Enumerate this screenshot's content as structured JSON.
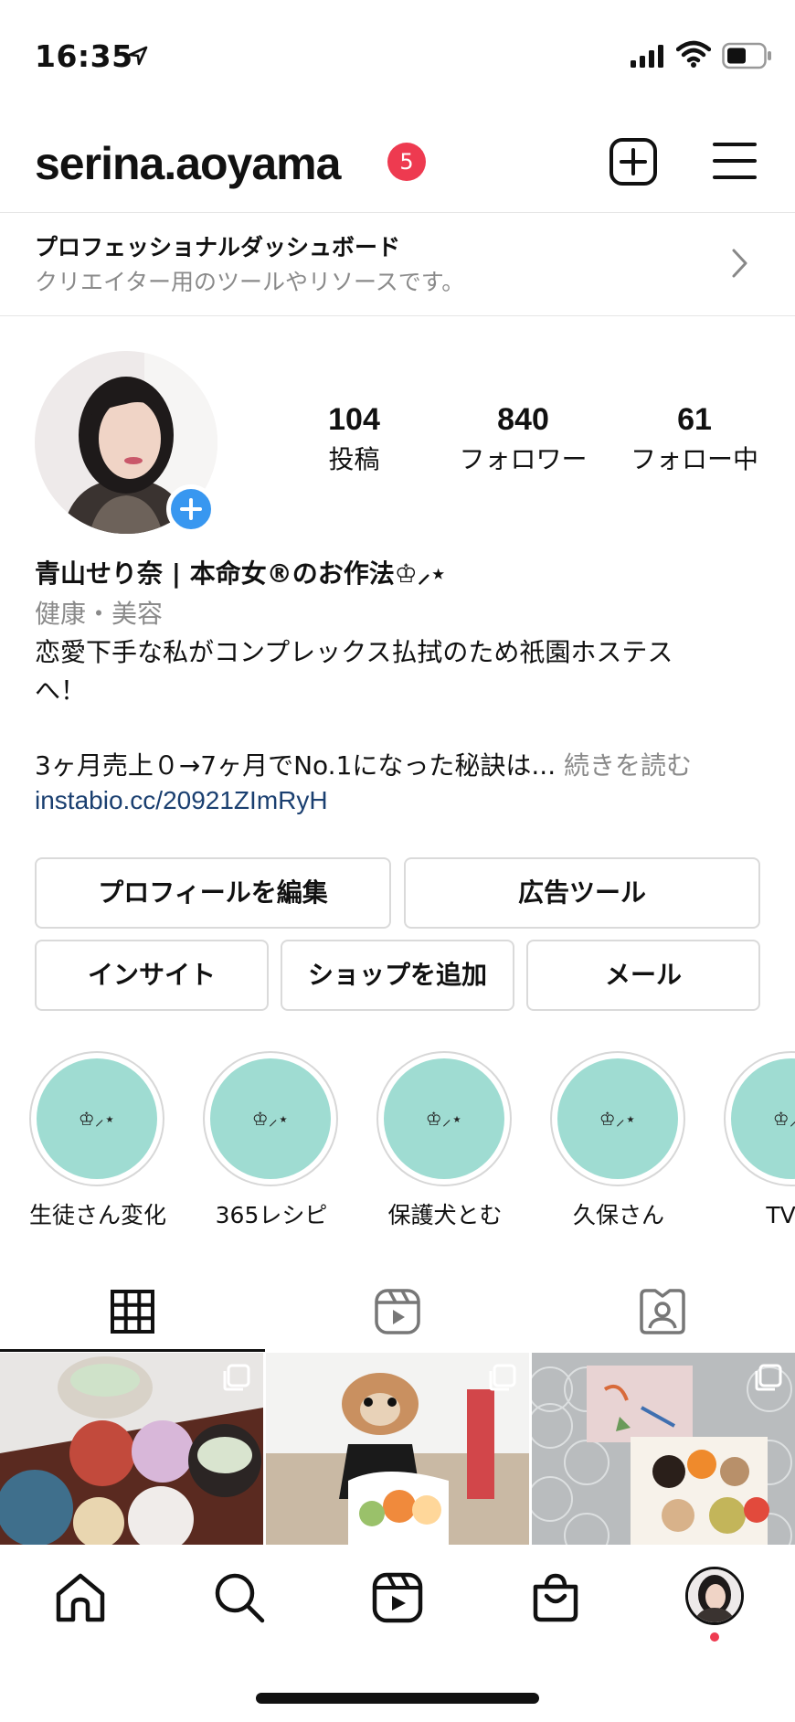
{
  "status_bar": {
    "time": "16:35"
  },
  "header": {
    "username": "serina.aoyama",
    "notification_count": "5"
  },
  "dashboard": {
    "title": "プロフェッショナルダッシュボード",
    "subtitle": "クリエイター用のツールやリソースです。"
  },
  "stats": [
    {
      "value": "104",
      "label": "投稿"
    },
    {
      "value": "840",
      "label": "フォロワー"
    },
    {
      "value": "61",
      "label": "フォロー中"
    }
  ],
  "bio": {
    "name": "青山せり奈 | 本命女®のお作法♔⸝⋆",
    "category": "健康・美容",
    "line1": "恋愛下手な私がコンプレックス払拭のため祇園ホステス",
    "line2": "へ！",
    "line3": "3ヶ月売上０→7ヶ月でNo.1になった秘訣は...",
    "more": "続きを読む",
    "link": "instabio.cc/20921ZImRyH"
  },
  "buttons": {
    "edit_profile": "プロフィールを編集",
    "ad_tools": "広告ツール",
    "insights": "インサイト",
    "add_shop": "ショップを追加",
    "email": "メール"
  },
  "highlights": [
    {
      "inner": "♔⸝⋆",
      "label": "生徒さん変化"
    },
    {
      "inner": "♔⸝⋆",
      "label": "365レシピ"
    },
    {
      "inner": "♔⸝⋆",
      "label": "保護犬とむ"
    },
    {
      "inner": "♔⸝⋆",
      "label": "久保さん"
    },
    {
      "inner": "♔⸝⋆",
      "label": "TV出"
    }
  ],
  "colors": {
    "accent_blue": "#3897f0",
    "badge_red": "#ee3a50",
    "highlight_teal": "#9fdcd2",
    "link_blue": "#1a3f70"
  }
}
